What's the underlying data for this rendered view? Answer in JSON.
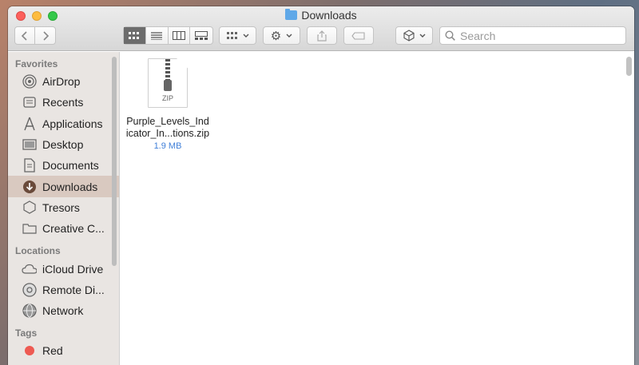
{
  "window": {
    "title": "Downloads"
  },
  "toolbar": {
    "search_placeholder": "Search"
  },
  "sidebar": {
    "sections": [
      {
        "header": "Favorites",
        "items": [
          {
            "label": "AirDrop",
            "icon": "airdrop-icon"
          },
          {
            "label": "Recents",
            "icon": "recents-icon"
          },
          {
            "label": "Applications",
            "icon": "applications-icon"
          },
          {
            "label": "Desktop",
            "icon": "desktop-icon"
          },
          {
            "label": "Documents",
            "icon": "documents-icon"
          },
          {
            "label": "Downloads",
            "icon": "downloads-icon",
            "selected": true
          },
          {
            "label": "Tresors",
            "icon": "tresors-icon"
          },
          {
            "label": "Creative C...",
            "icon": "folder-icon"
          }
        ]
      },
      {
        "header": "Locations",
        "items": [
          {
            "label": "iCloud Drive",
            "icon": "icloud-icon"
          },
          {
            "label": "Remote Di...",
            "icon": "remote-disc-icon"
          },
          {
            "label": "Network",
            "icon": "network-icon"
          }
        ]
      },
      {
        "header": "Tags",
        "items": [
          {
            "label": "Red",
            "icon": "red-tag-icon"
          }
        ]
      }
    ]
  },
  "content": {
    "files": [
      {
        "name_line1": "Purple_Levels_Ind",
        "name_line2": "icator_In...tions.zip",
        "size": "1.9 MB",
        "type_label": "ZIP"
      }
    ]
  },
  "colors": {
    "selection": "#d9c9c0",
    "accent": "#3f7fd8",
    "close": "#fc605c",
    "minimize": "#fdbc40",
    "maximize": "#34c84a"
  }
}
